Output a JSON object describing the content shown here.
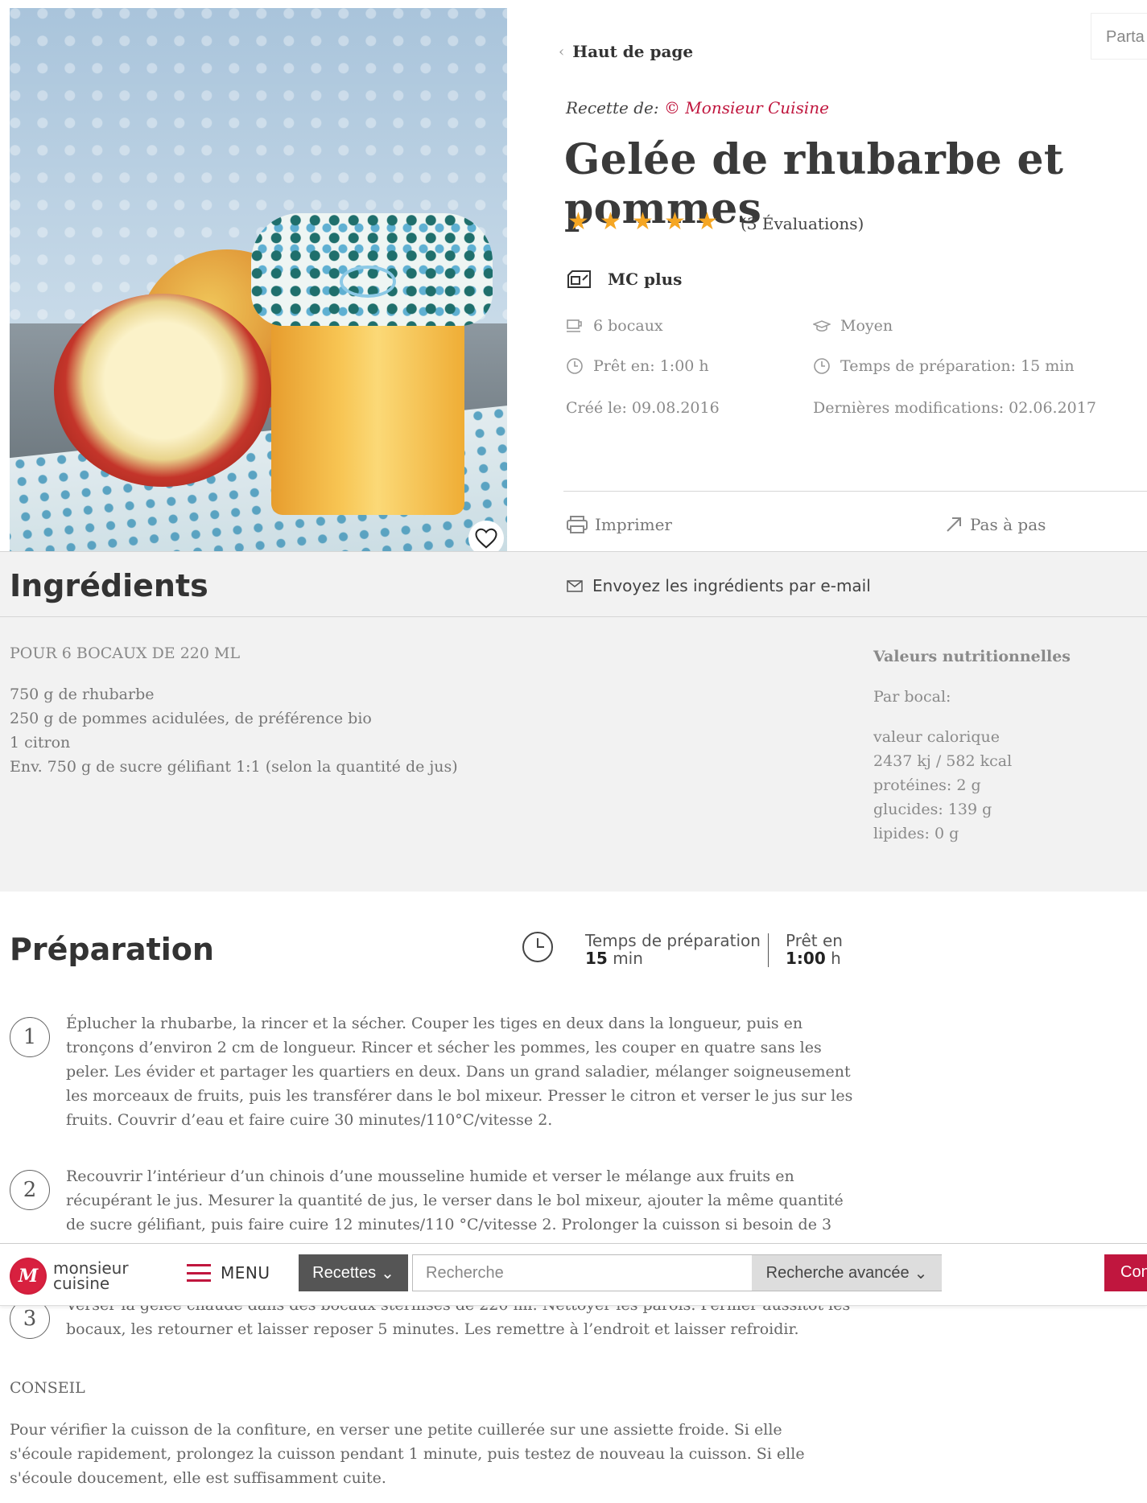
{
  "share": {
    "label": "Parta"
  },
  "back": {
    "label": "Haut de page"
  },
  "recipe": {
    "author_prefix": "Recette de:",
    "author": "© Monsieur Cuisine",
    "title": "Gelée de rhubarbe et pommes",
    "rating": 5,
    "ratings_text": "(3 Évaluations)",
    "device": "MC plus",
    "portions": "6 bocaux",
    "difficulty": "Moyen",
    "ready_in": "Prêt en: 1:00 h",
    "prep_time": "Temps de préparation: 15 min",
    "created": "Créé le: 09.08.2016",
    "modified": "Dernières modifications: 02.06.2017"
  },
  "actions": {
    "print": "Imprimer",
    "step_by_step": "Pas à pas"
  },
  "ingredients": {
    "title": "Ingrédients",
    "email_link": "Envoyez les ingrédients par e-mail",
    "yield": "POUR 6 BOCAUX DE 220 ML",
    "items": [
      "750 g de rhubarbe",
      "250 g de pommes acidulées, de préférence bio",
      "1 citron",
      "Env. 750 g de sucre gélifiant 1:1 (selon la quantité de jus)"
    ],
    "nutrition": {
      "heading": "Valeurs nutritionnelles",
      "per": "Par bocal:",
      "calorie_label": "valeur calorique",
      "calorie_value": "2437 kj / 582 kcal",
      "protein": "protéines: 2 g",
      "carbs": "glucides: 139 g",
      "fat": "lipides: 0 g"
    }
  },
  "preparation": {
    "title": "Préparation",
    "prep_label": "Temps de préparation",
    "prep_value": "15",
    "prep_unit": "min",
    "ready_label": "Prêt en",
    "ready_value": "1:00",
    "ready_unit": "h",
    "steps": [
      {
        "num": "1",
        "text": "Éplucher la rhubarbe, la rincer et la sécher. Couper les tiges en deux dans la longueur, puis en tronçons d’environ 2 cm de longueur. Rincer et sécher les pommes, les couper en quatre sans les peler. Les évider et partager les quartiers en deux. Dans un grand saladier, mélanger soigneusement les morceaux de fruits, puis les transférer dans le bol mixeur. Presser le citron et verser le jus sur les fruits. Couvrir d’eau et faire cuire 30 minutes/110°C/vitesse 2."
      },
      {
        "num": "2",
        "text": "Recouvrir l’intérieur d’un chinois d’une mousseline humide et verser le mélange aux fruits en récupérant le jus. Mesurer la quantité de jus, le verser dans le bol mixeur, ajouter la même quantité de sucre gélifiant, puis faire cuire 12 minutes/110 °C/vitesse 2. Prolonger la cuisson si besoin de 3"
      },
      {
        "num": "3",
        "text": "Verser la gelée chaude dans des bocaux stérilisés de 220 ml. Nettoyer les parois. Fermer aussitôt les bocaux, les retourner et laisser reposer 5 minutes. Les remettre à l’endroit et laisser refroidir."
      }
    ],
    "tip_heading": "CONSEIL",
    "tip_text": "Pour vérifier la cuisson de la confiture, en verser une petite cuillerée sur une assiette froide. Si elle s'écoule rapidement, prolongez la cuisson pendant 1 minute, puis testez de nouveau la cuisson. Si elle s'écoule doucement, elle est suffisamment cuite."
  },
  "nav": {
    "logo_line1": "monsieur",
    "logo_line2": "cuisine",
    "menu": "MENU",
    "recipes": "Recettes",
    "search_placeholder": "Recherche",
    "advanced": "Recherche avancée",
    "connect": "Con"
  },
  "colors": {
    "brand": "#c0163e",
    "star": "#f5a623",
    "section_bg": "#f2f2f2"
  }
}
